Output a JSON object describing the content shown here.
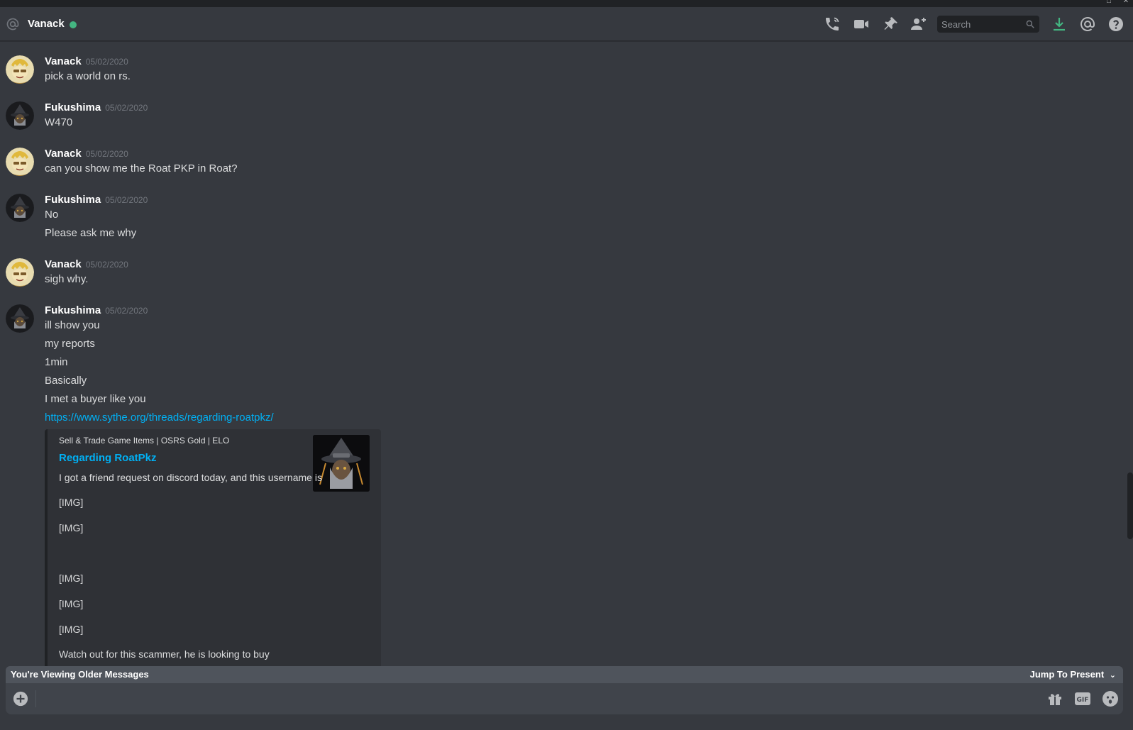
{
  "header": {
    "channel_name": "Vanack",
    "status_color": "#43b581",
    "search": {
      "placeholder": "Search"
    },
    "icons": [
      "at-icon",
      "voice-call-icon",
      "video-call-icon",
      "pin-icon",
      "add-friend-icon",
      "search-icon",
      "download-icon",
      "mention-icon",
      "help-icon"
    ]
  },
  "messages": [
    {
      "author": "Vanack",
      "timestamp": "05/02/2020",
      "lines": [
        "pick a world on rs."
      ]
    },
    {
      "author": "Fukushima",
      "timestamp": "05/02/2020",
      "lines": [
        "W470"
      ]
    },
    {
      "author": "Vanack",
      "timestamp": "05/02/2020",
      "lines": [
        "can you show me the Roat PKP in Roat?"
      ]
    },
    {
      "author": "Fukushima",
      "timestamp": "05/02/2020",
      "lines": [
        "No",
        "Please ask me why"
      ]
    },
    {
      "author": "Vanack",
      "timestamp": "05/02/2020",
      "lines": [
        "sigh why."
      ]
    },
    {
      "author": "Fukushima",
      "timestamp": "05/02/2020",
      "lines": [
        "ill show you",
        "my reports",
        "1min",
        "Basically",
        "I met a buyer like you",
        "https://www.sythe.org/threads/regarding-roatpkz/"
      ]
    }
  ],
  "embed": {
    "provider": "Sell & Trade Game Items | OSRS Gold | ELO",
    "title": "Regarding RoatPkz",
    "description_lines": [
      "I got a friend request on discord today, and this username is",
      "[IMG]",
      "[IMG]",
      "",
      "[IMG]",
      "[IMG]",
      "[IMG]",
      "Watch out for this scammer, he is looking to buy"
    ]
  },
  "older_bar": {
    "label": "You're Viewing Older Messages",
    "jump_label": "Jump To Present"
  },
  "composer": {
    "icons": [
      "attach-plus-icon",
      "gift-icon",
      "gif-icon",
      "emoji-icon"
    ],
    "gif_label": "GIF"
  },
  "colors": {
    "background": "#36393f",
    "link": "#00b0f4",
    "embed_bg": "#2f3136",
    "composer_bg": "#40444b",
    "older_bar_bg": "#4f545c",
    "download_green": "#43b581"
  }
}
